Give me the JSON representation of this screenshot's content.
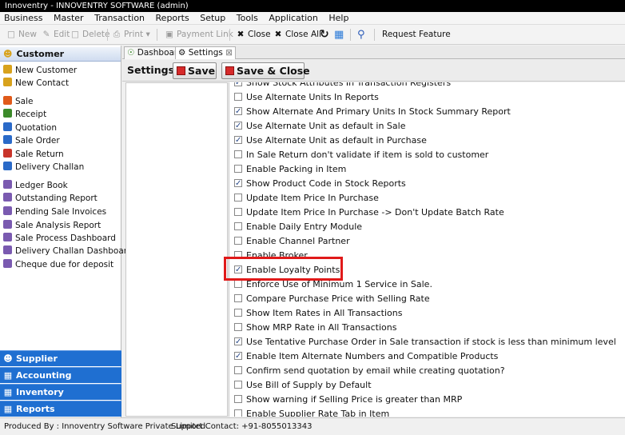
{
  "window": {
    "title": "Innoventry - INNOVENTRY SOFTWARE (admin)"
  },
  "menu": [
    "Business",
    "Master",
    "Transaction",
    "Reports",
    "Setup",
    "Tools",
    "Application",
    "Help"
  ],
  "toolbar": {
    "new": "New",
    "edit": "Edit",
    "delete": "Delete",
    "print": "Print",
    "payment_link": "Payment Link",
    "close": "Close",
    "close_all": "Close All",
    "request_feature": "Request Feature"
  },
  "sidebar": {
    "header": "Customer",
    "items": [
      {
        "label": "New Customer",
        "color": "#d8a21c"
      },
      {
        "label": "New Contact",
        "color": "#d8a21c"
      },
      {
        "label": "Sale",
        "color": "#e05a1a"
      },
      {
        "label": "Receipt",
        "color": "#3c8a2a"
      },
      {
        "label": "Quotation",
        "color": "#2a6ac8"
      },
      {
        "label": "Sale Order",
        "color": "#2a6ac8"
      },
      {
        "label": "Sale Return",
        "color": "#c8342a"
      },
      {
        "label": "Delivery Challan",
        "color": "#2a6ac8"
      },
      {
        "label": "Ledger Book",
        "color": "#7a5ab0"
      },
      {
        "label": "Outstanding Report",
        "color": "#7a5ab0"
      },
      {
        "label": "Pending Sale Invoices",
        "color": "#7a5ab0"
      },
      {
        "label": "Sale Analysis Report",
        "color": "#7a5ab0"
      },
      {
        "label": "Sale Process Dashboard",
        "color": "#7a5ab0"
      },
      {
        "label": "Delivery Challan Dashboard",
        "color": "#7a5ab0"
      },
      {
        "label": "Cheque due for deposit",
        "color": "#7a5ab0"
      }
    ],
    "accordion": [
      "Supplier",
      "Accounting",
      "Inventory",
      "Reports"
    ]
  },
  "tabs": [
    {
      "label": "Dashboard"
    },
    {
      "label": "Settings"
    }
  ],
  "settings": {
    "label": "Settings:",
    "save": "Save",
    "save_close": "Save & Close",
    "options": [
      {
        "label": "Show Stock Attributes In Transaction Registers",
        "checked": true
      },
      {
        "label": "Use Alternate Units In Reports",
        "checked": false
      },
      {
        "label": "Show Alternate And Primary Units In Stock Summary Report",
        "checked": true
      },
      {
        "label": "Use Alternate Unit as default in Sale",
        "checked": true
      },
      {
        "label": "Use Alternate Unit as default in Purchase",
        "checked": true
      },
      {
        "label": "In Sale Return don't validate if item is sold to customer",
        "checked": false
      },
      {
        "label": "Enable Packing in Item",
        "checked": false
      },
      {
        "label": "Show Product Code in Stock Reports",
        "checked": true
      },
      {
        "label": "Update Item Price In Purchase",
        "checked": false
      },
      {
        "label": "Update Item Price In Purchase -> Don't Update Batch Rate",
        "checked": false
      },
      {
        "label": "Enable Daily Entry Module",
        "checked": false
      },
      {
        "label": "Enable Channel Partner",
        "checked": false
      },
      {
        "label": "Enable Broker",
        "checked": false
      },
      {
        "label": "Enable Loyalty Points",
        "checked": true
      },
      {
        "label": "Enforce Use of Minimum 1 Service in Sale.",
        "checked": false
      },
      {
        "label": "Compare Purchase Price with Selling Rate",
        "checked": false
      },
      {
        "label": "Show Item Rates in All Transactions",
        "checked": false
      },
      {
        "label": "Show MRP Rate in All Transactions",
        "checked": false
      },
      {
        "label": "Use Tentative Purchase Order in Sale transaction if stock is less than minimum level",
        "checked": true
      },
      {
        "label": "Enable Item Alternate Numbers and Compatible Products",
        "checked": true
      },
      {
        "label": "Confirm send quotation by email while creating quotation?",
        "checked": false
      },
      {
        "label": "Use Bill of Supply by Default",
        "checked": false
      },
      {
        "label": "Show warning if Selling Price is greater than MRP",
        "checked": false
      },
      {
        "label": "Enable Supplier Rate Tab in Item",
        "checked": false
      }
    ]
  },
  "status": {
    "produced_by": "Produced By : Innoventry Software Private Limited",
    "support": "Support Contact: +91-8055013343"
  },
  "colors": {
    "highlight": "#e01a1a",
    "accordion": "#1f6fd1"
  }
}
